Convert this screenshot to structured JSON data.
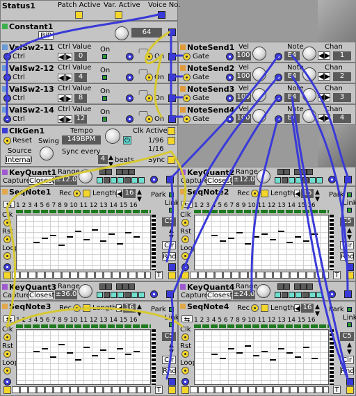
{
  "status": {
    "title": "Status1",
    "patch_active": "Patch Active",
    "var_active": "Var. Active",
    "voice_no": "Voice No."
  },
  "constant": {
    "title": "Constant1",
    "mode": "BiP",
    "value": "64"
  },
  "valsw": [
    {
      "title": "ValSw2-11",
      "ctrl_label": "Ctrl",
      "ctrl_value_label": "Ctrl Value",
      "value": "0",
      "on": "On"
    },
    {
      "title": "ValSw2-12",
      "ctrl_label": "Ctrl",
      "ctrl_value_label": "Ctrl Value",
      "value": "4",
      "on": "On"
    },
    {
      "title": "ValSw2-13",
      "ctrl_label": "Ctrl",
      "ctrl_value_label": "Ctrl Value",
      "value": "8",
      "on": "On"
    },
    {
      "title": "ValSw2-14",
      "ctrl_label": "Ctrl",
      "ctrl_value_label": "Ctrl Value",
      "value": "12",
      "on": "On"
    }
  ],
  "notesend": [
    {
      "title": "NoteSend1",
      "gate": "Gate",
      "vel_label": "Vel",
      "vel": "100",
      "note_label": "Note",
      "note": "E4",
      "chan_label": "Chan",
      "chan": "1"
    },
    {
      "title": "NoteSend2",
      "gate": "Gate",
      "vel_label": "Vel",
      "vel": "100",
      "note_label": "Note",
      "note": "E4",
      "chan_label": "Chan",
      "chan": "2"
    },
    {
      "title": "NoteSend3",
      "gate": "Gate",
      "vel_label": "Vel",
      "vel": "100",
      "note_label": "Note",
      "note": "E4",
      "chan_label": "Chan",
      "chan": "3"
    },
    {
      "title": "NoteSend4",
      "gate": "Gate",
      "vel_label": "Vel",
      "vel": "100",
      "note_label": "Note",
      "note": "E4",
      "chan_label": "Chan",
      "chan": "4"
    }
  ],
  "clkgen": {
    "title": "ClkGen1",
    "tempo_label": "Tempo",
    "tempo": "149BPM",
    "reset": "Reset",
    "swing": "Swing",
    "source_label": "Source",
    "source": "Internal",
    "clk_active": "Clk Active",
    "div1": "1/96",
    "div2": "1/16",
    "sync_every": "Sync every",
    "sync_value": "4",
    "beats": "beats",
    "sync": "Sync"
  },
  "keyquant": [
    {
      "title": "KeyQuant1",
      "range_label": "Range",
      "range": "±12.0",
      "capture": "Capture",
      "mode": "Closest"
    },
    {
      "title": "KeyQuant2",
      "range_label": "Range",
      "range": "±12.0",
      "capture": "Capture",
      "mode": "Closest"
    },
    {
      "title": "KeyQuant3",
      "range_label": "Range",
      "range": "±36.0",
      "capture": "Capture",
      "mode": "Closest"
    },
    {
      "title": "KeyQuant4",
      "range_label": "Range",
      "range": "±24.0",
      "capture": "Capture",
      "mode": "Closest"
    }
  ],
  "seqnote": [
    {
      "title": "SeqNote1",
      "rec": "Rec",
      "length_label": "Length",
      "length": "16",
      "park": "Park",
      "link": "Link",
      "clk": "Clk",
      "rst": "Rst",
      "loop": "Loop",
      "note": "C5",
      "clr": "Clr",
      "rnd": "Rnd",
      "t": "T",
      "steps": "1 2 3 4 5 6 7 8 9 10 11 12 13 14 15 16"
    },
    {
      "title": "SeqNote2",
      "rec": "Rec",
      "length_label": "Length",
      "length": "16",
      "park": "Park",
      "link": "Link",
      "clk": "Clk",
      "rst": "Rst",
      "loop": "Loop",
      "note": "C5",
      "clr": "Clr",
      "rnd": "Rnd",
      "t": "T",
      "steps": "1 2 3 4 5 6 7 8 9 10 11 12 13 14 15 16"
    },
    {
      "title": "SeqNote3",
      "rec": "Rec",
      "length_label": "Length",
      "length": "16",
      "park": "Park",
      "link": "Link",
      "clk": "Clk",
      "rst": "Rst",
      "loop": "Loop",
      "note": "C5",
      "clr": "Clr",
      "rnd": "Rnd",
      "t": "T",
      "steps": "1 2 3 4 5 6 7 8 9 10 11 12 13 14 15 16"
    },
    {
      "title": "SeqNote4",
      "rec": "Rec",
      "length_label": "Length",
      "length": "16",
      "park": "Park",
      "link": "Link",
      "clk": "Clk",
      "rst": "Rst",
      "loop": "Loop",
      "note": "C5",
      "clr": "Clr",
      "rnd": "Rnd",
      "t": "T",
      "steps": "1 2 3 4 5 6 7 8 9 10 11 12 13 14 15 16"
    }
  ],
  "colors": {
    "module_bg": "#c4c4c4",
    "cable_blue": "#3a3ad8",
    "cable_yellow": "#d6c830",
    "led_green": "#2a9a2a"
  }
}
